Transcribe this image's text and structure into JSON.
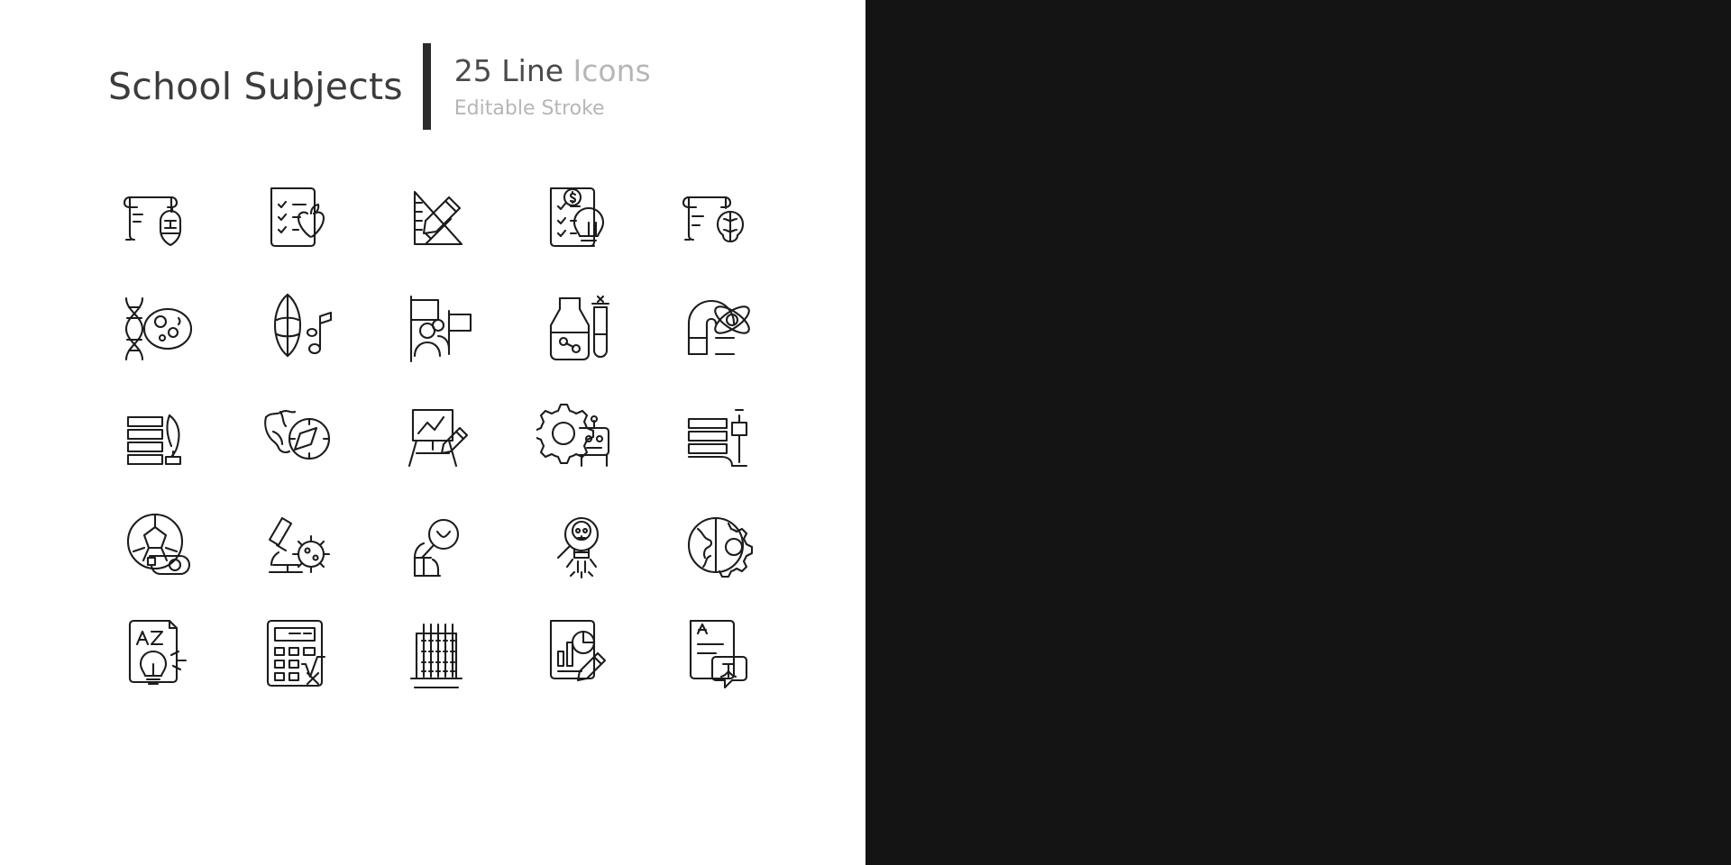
{
  "header": {
    "title": "School Subjects",
    "count_text": "25 Line ",
    "count_muted": "Icons",
    "stroke_text": "Editable Stroke"
  },
  "panels": [
    {
      "name": "light-theme-panel",
      "mode": "light",
      "background": "#ffffff",
      "stroke": "#1c1c1c"
    },
    {
      "name": "dark-theme-panel",
      "mode": "dark",
      "background": "#141414",
      "stroke": "#f2f2f2"
    }
  ],
  "icons": [
    {
      "id": "history-scroll-knight",
      "label": "History"
    },
    {
      "id": "health-education-apple-checklist",
      "label": "Health education"
    },
    {
      "id": "geometry-ruler-triangle-pencil",
      "label": "Geometry"
    },
    {
      "id": "business-studies-dollar-lightbulb",
      "label": "Business studies"
    },
    {
      "id": "psychology-scroll-brain",
      "label": "Psychology"
    },
    {
      "id": "biology-dna-cell",
      "label": "Biology"
    },
    {
      "id": "music-instrument-notes",
      "label": "Music"
    },
    {
      "id": "social-studies-people-flag",
      "label": "Social studies"
    },
    {
      "id": "chemistry-beaker-test-tube",
      "label": "Chemistry"
    },
    {
      "id": "physics-magnet-atom",
      "label": "Physics"
    },
    {
      "id": "literature-books-quill",
      "label": "Literature"
    },
    {
      "id": "geography-globe-compass",
      "label": "Geography"
    },
    {
      "id": "art-easel-pencil",
      "label": "Art"
    },
    {
      "id": "robotics-gear-robot",
      "label": "Robotics"
    },
    {
      "id": "library-science-books-lamp",
      "label": "Library science"
    },
    {
      "id": "physical-education-ball-whistle",
      "label": "Physical education"
    },
    {
      "id": "microbiology-microscope-virus",
      "label": "Microbiology"
    },
    {
      "id": "research-magnifier-person",
      "label": "Research"
    },
    {
      "id": "anatomy-skeleton-magnifier",
      "label": "Anatomy"
    },
    {
      "id": "environmental-earth-gear",
      "label": "Environmental science"
    },
    {
      "id": "vocabulary-az-lightbulb",
      "label": "Vocabulary"
    },
    {
      "id": "mathematics-calculator-sqrt",
      "label": "Mathematics"
    },
    {
      "id": "computer-science-abacus-binary",
      "label": "Computer science"
    },
    {
      "id": "statistics-chart-pencil",
      "label": "Statistics"
    },
    {
      "id": "foreign-language-translation",
      "label": "Foreign language"
    }
  ]
}
